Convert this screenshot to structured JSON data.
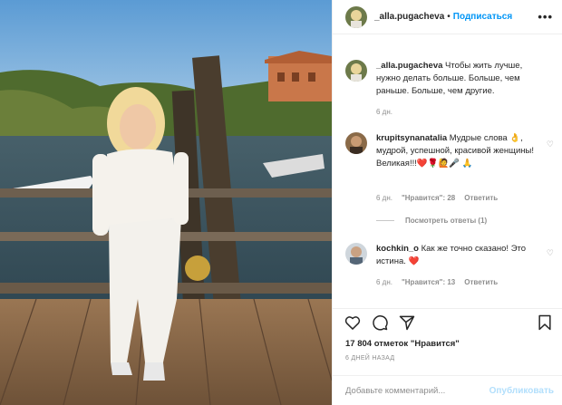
{
  "post": {
    "username": "_alla.pugacheva",
    "follow_label": "Подписаться",
    "separator": "•",
    "more_label": "•••",
    "caption_text": "Чтобы жить лучше, нужно делать больше. Больше, чем раньше. Больше, чем другие.",
    "caption_time": "6 дн.",
    "likes_text": "17 804 отметок \"Нравится\"",
    "timestamp": "6 ДНЕЙ НАЗАД"
  },
  "comments": [
    {
      "username": "krupitsynanatalia",
      "text": "Мудрые слова 👌, мудрой, успешной, красивой женщины! Великая!!!❤️🌹🙋🎤 🙏",
      "time": "6 дн.",
      "likes": "\"Нравится\": 28",
      "reply_label": "Ответить",
      "view_replies": "Посмотреть ответы (1)"
    },
    {
      "username": "kochkin_o",
      "text": "Как же точно сказано! Это истина. ❤️",
      "time": "6 дн.",
      "likes": "\"Нравится\": 13",
      "reply_label": "Ответить"
    }
  ],
  "comment_box": {
    "placeholder": "Добавьте комментарий...",
    "publish_label": "Опубликовать"
  },
  "icons": [
    "heart-icon",
    "comment-icon",
    "share-icon",
    "bookmark-icon"
  ],
  "colors": {
    "accent": "#0095f6",
    "publish_disabled": "#b2dffc",
    "muted": "#8e8e8e"
  }
}
